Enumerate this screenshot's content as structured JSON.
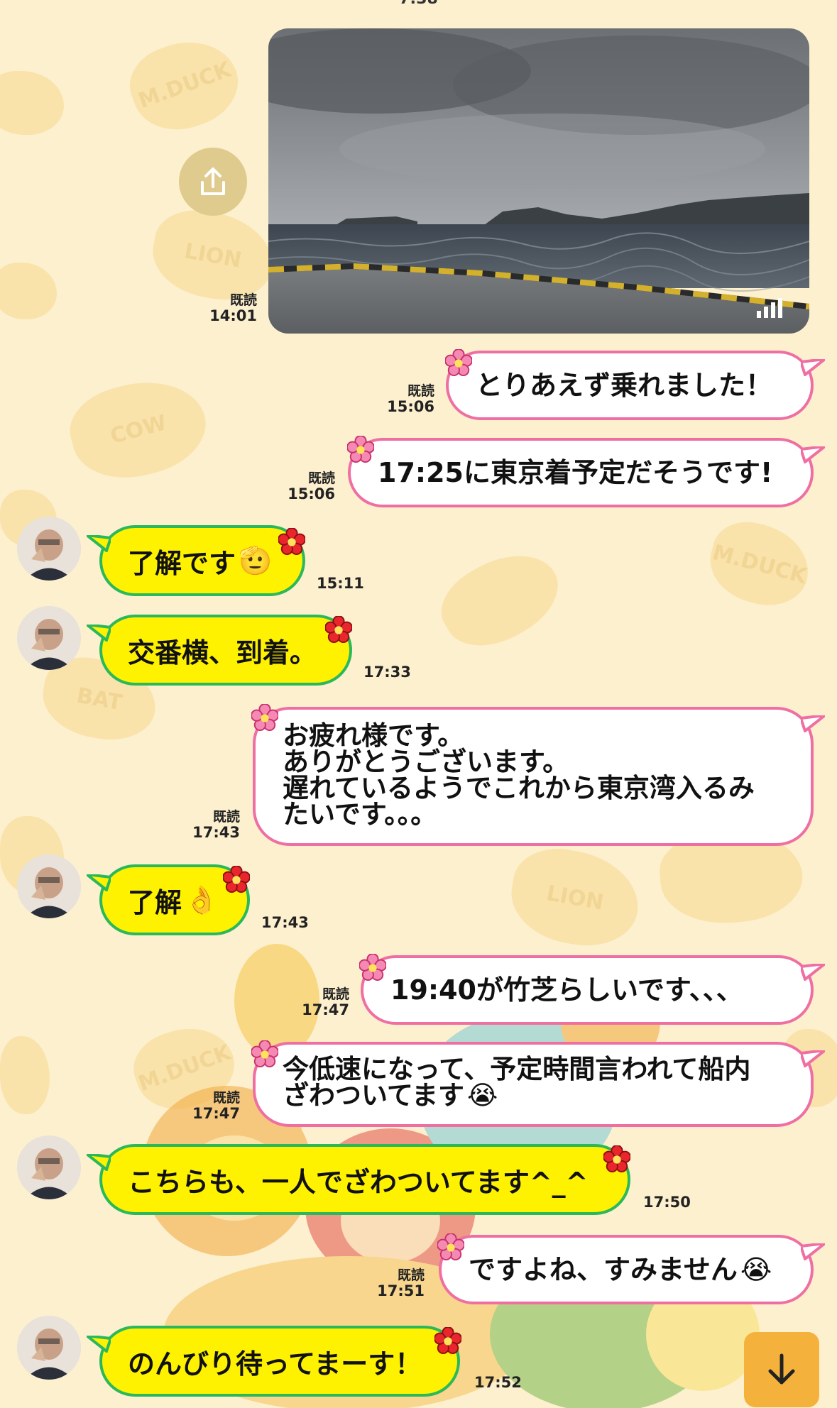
{
  "header": {
    "partial_time": "7:38"
  },
  "photo_message": {
    "read": "既読",
    "time": "14:01"
  },
  "messages": [
    {
      "id": "m1",
      "side": "out",
      "text": "とりあえず乗れました！",
      "read": "既読",
      "time": "15:06"
    },
    {
      "id": "m2",
      "side": "out",
      "text": "17:25に東京着予定だそうです!",
      "read": "既読",
      "time": "15:06"
    },
    {
      "id": "m3",
      "side": "in",
      "text": "了解です",
      "emoji": "🫡",
      "time": "15:11"
    },
    {
      "id": "m4",
      "side": "in",
      "text": "交番横、到着。",
      "time": "17:33"
    },
    {
      "id": "m5",
      "side": "out",
      "lines": [
        "お疲れ様です。",
        "ありがとうございます。",
        "遅れているようでこれから東京湾入るみ",
        "たいです。。。"
      ],
      "read": "既読",
      "time": "17:43"
    },
    {
      "id": "m6",
      "side": "in",
      "text": "了解",
      "emoji": "👌",
      "time": "17:43"
    },
    {
      "id": "m7",
      "side": "out",
      "text": "19:40が竹芝らしいです、、、",
      "read": "既読",
      "time": "17:47"
    },
    {
      "id": "m8",
      "side": "out",
      "lines": [
        "今低速になって、予定時間言われて船内",
        "ざわついてます"
      ],
      "emoji": "😭",
      "read": "既読",
      "time": "17:47"
    },
    {
      "id": "m9",
      "side": "in",
      "text": "こちらも、一人でざわついてます^_^",
      "time": "17:50"
    },
    {
      "id": "m10",
      "side": "out",
      "text": "ですよね、すみません",
      "emoji": "😭",
      "read": "既読",
      "time": "17:51"
    },
    {
      "id": "m11",
      "side": "in",
      "text": "のんびり待ってまーす！",
      "time": "17:52"
    }
  ],
  "background_labels": [
    "M.DUCK",
    "LION",
    "COW",
    "BAT",
    "M.DUCK",
    "LION",
    "M.DUCK",
    "M.DUCK"
  ],
  "icons": {
    "share": "share-icon",
    "scroll": "arrow-down-icon",
    "flower_out": "pink-flower-icon",
    "flower_in": "red-flower-icon"
  },
  "colors": {
    "background": "#fdf0cf",
    "outgoing_border": "#ef6fa3",
    "incoming_fill": "#fff200",
    "incoming_border": "#2bb85a",
    "scroll_button": "#f4b23c"
  }
}
